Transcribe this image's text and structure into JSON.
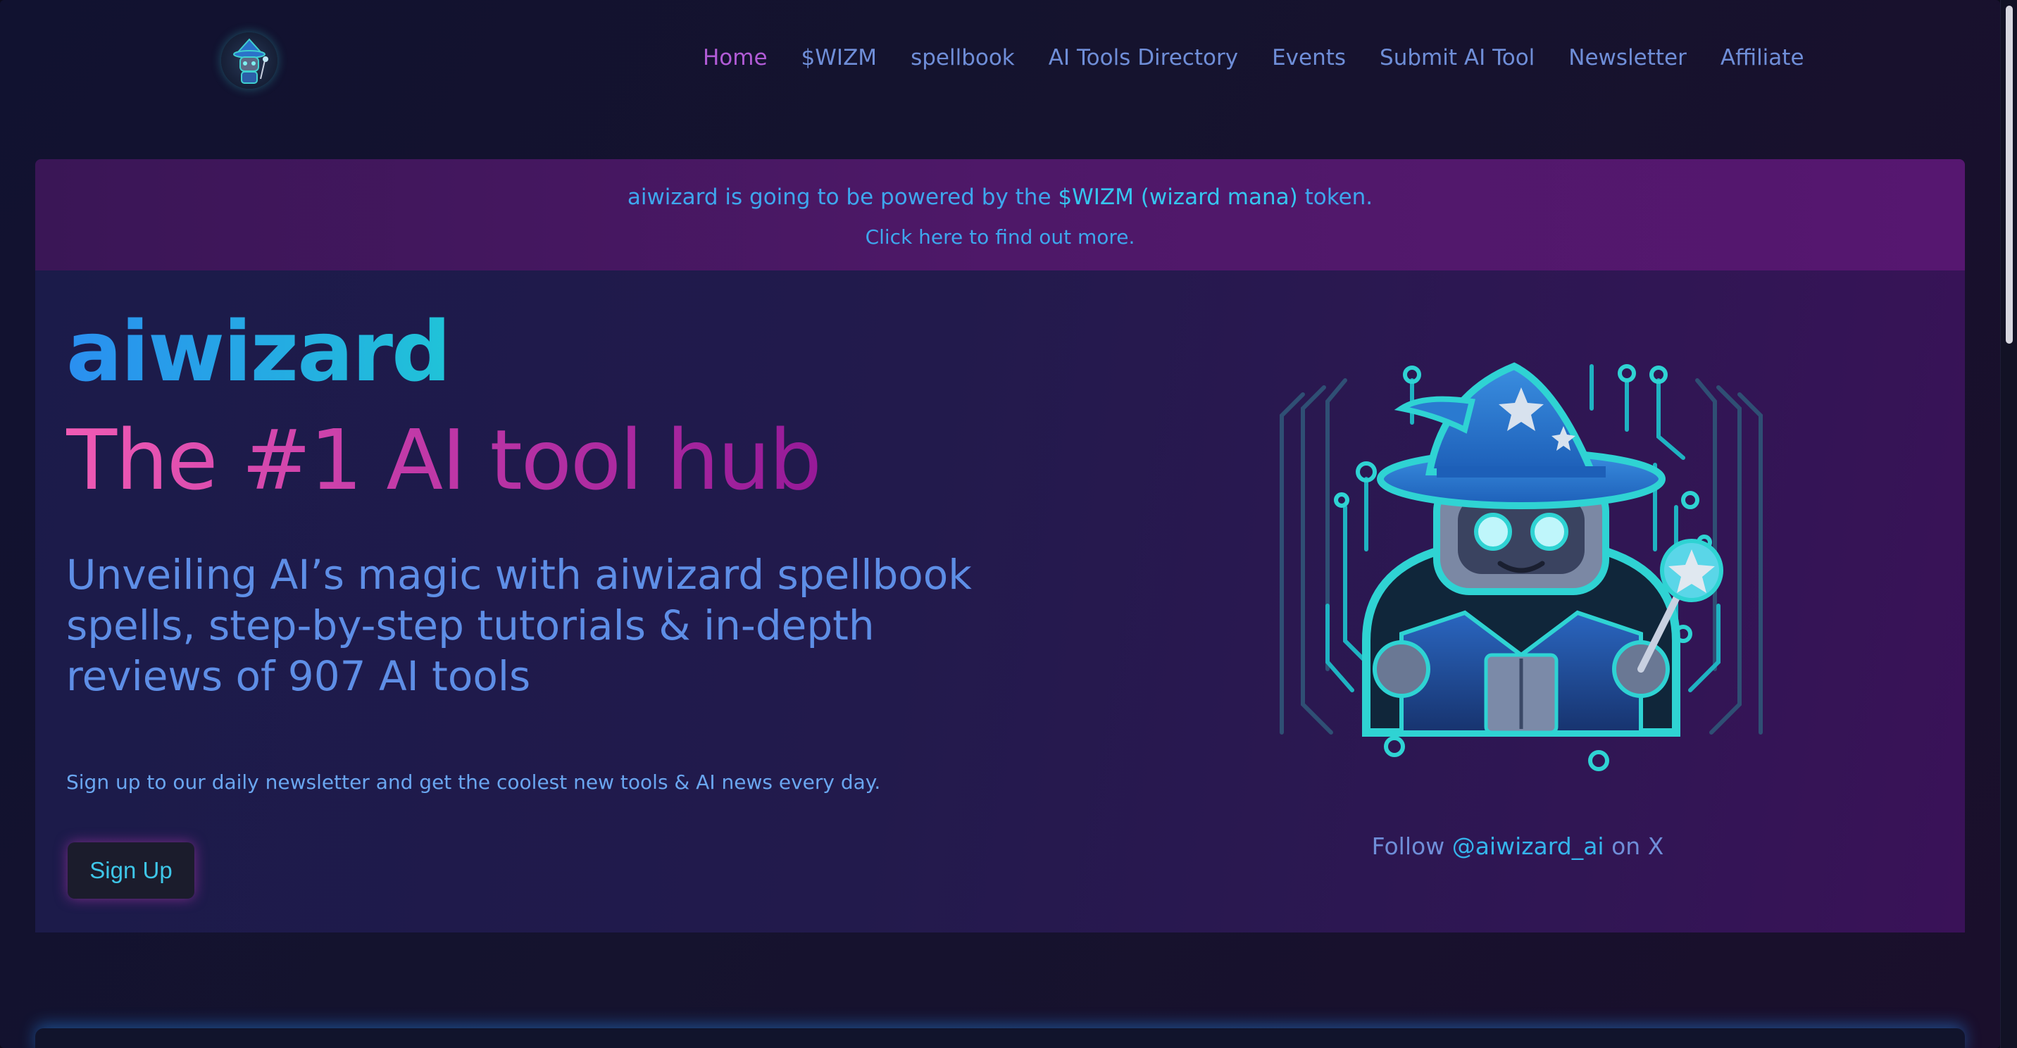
{
  "nav": {
    "logo_icon": "wizard-robot-logo-icon",
    "links": [
      {
        "label": "Home",
        "active": true
      },
      {
        "label": "$WIZM"
      },
      {
        "label": "spellbook"
      },
      {
        "label": "AI Tools Directory"
      },
      {
        "label": "Events"
      },
      {
        "label": "Submit AI Tool"
      },
      {
        "label": "Newsletter"
      },
      {
        "label": "Affiliate"
      }
    ]
  },
  "banner": {
    "line1_pre": "aiwizard is going to be powered by the ",
    "line1_token": "$WIZM (wizard mana)",
    "line1_post": " token.",
    "line2": "Click here to find out more."
  },
  "hero": {
    "brand": "aiwizard",
    "tagline": "The #1 AI tool hub",
    "subtitle": "Unveiling AI’s magic with aiwizard spellbook spells, step-by-step tutorials & in-depth reviews of 907 AI tools",
    "newsletter_text": "Sign up to our daily newsletter and get the coolest new tools & AI news every day.",
    "signup_label": "Sign Up",
    "mascot_icon": "wizard-robot-mascot-icon",
    "follow_pre": "Follow ",
    "follow_handle": "@aiwizard_ai",
    "follow_post": " on X"
  },
  "colors": {
    "accent_cyan": "#36c6f0",
    "accent_pink": "#f05bb4",
    "nav_link": "#6f8ed8",
    "nav_active": "#b15bd6"
  }
}
